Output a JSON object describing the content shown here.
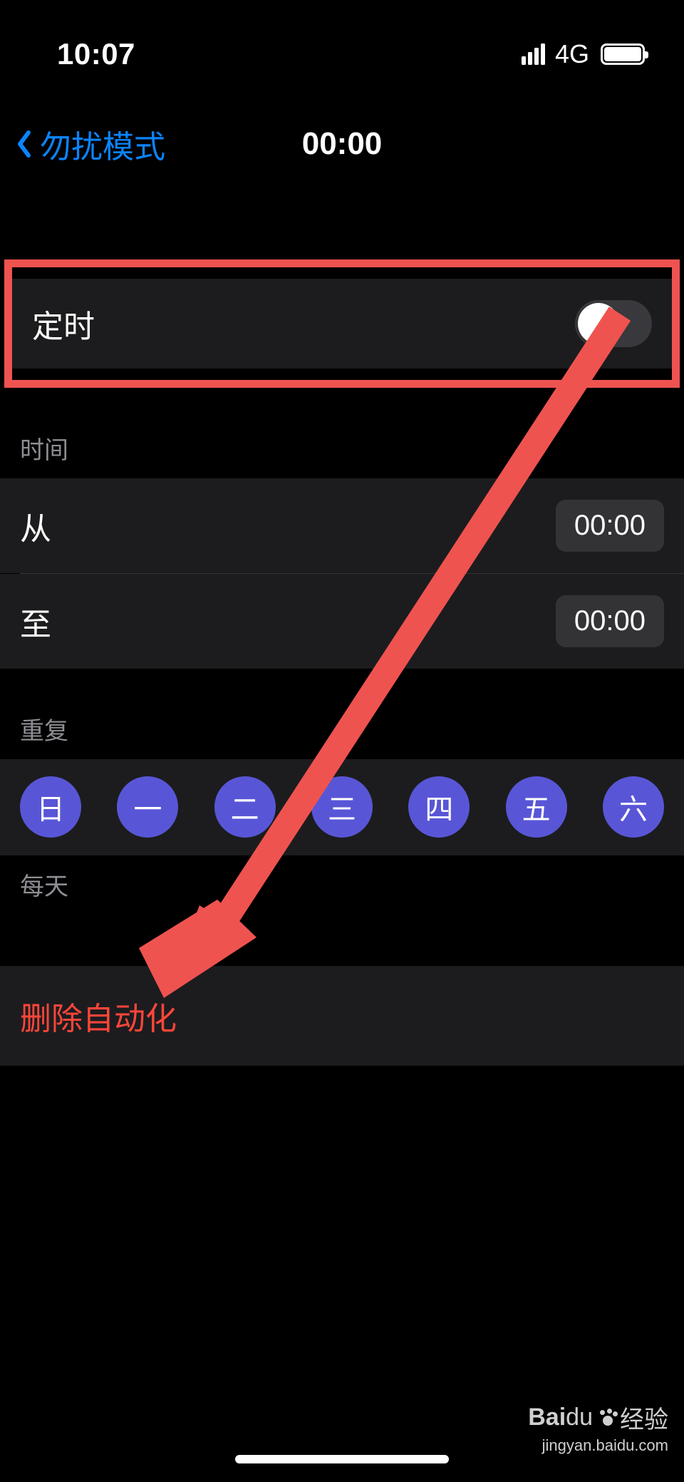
{
  "status": {
    "time": "10:07",
    "network": "4G"
  },
  "nav": {
    "back_label": "勿扰模式",
    "title": "00:00"
  },
  "toggle": {
    "label": "定时",
    "on": false
  },
  "time_section": {
    "header": "时间",
    "from_label": "从",
    "from_value": "00:00",
    "to_label": "至",
    "to_value": "00:00"
  },
  "repeat_section": {
    "header": "重复",
    "days": [
      "日",
      "一",
      "二",
      "三",
      "四",
      "五",
      "六"
    ],
    "footer": "每天"
  },
  "delete": {
    "label": "删除自动化"
  },
  "watermark": {
    "brand1": "Bai",
    "brand2": "du",
    "brand3": "经验",
    "url": "jingyan.baidu.com"
  },
  "colors": {
    "highlight": "#ef5350",
    "accent": "#5856d6",
    "link": "#0b84ff",
    "destructive": "#ff453a"
  }
}
